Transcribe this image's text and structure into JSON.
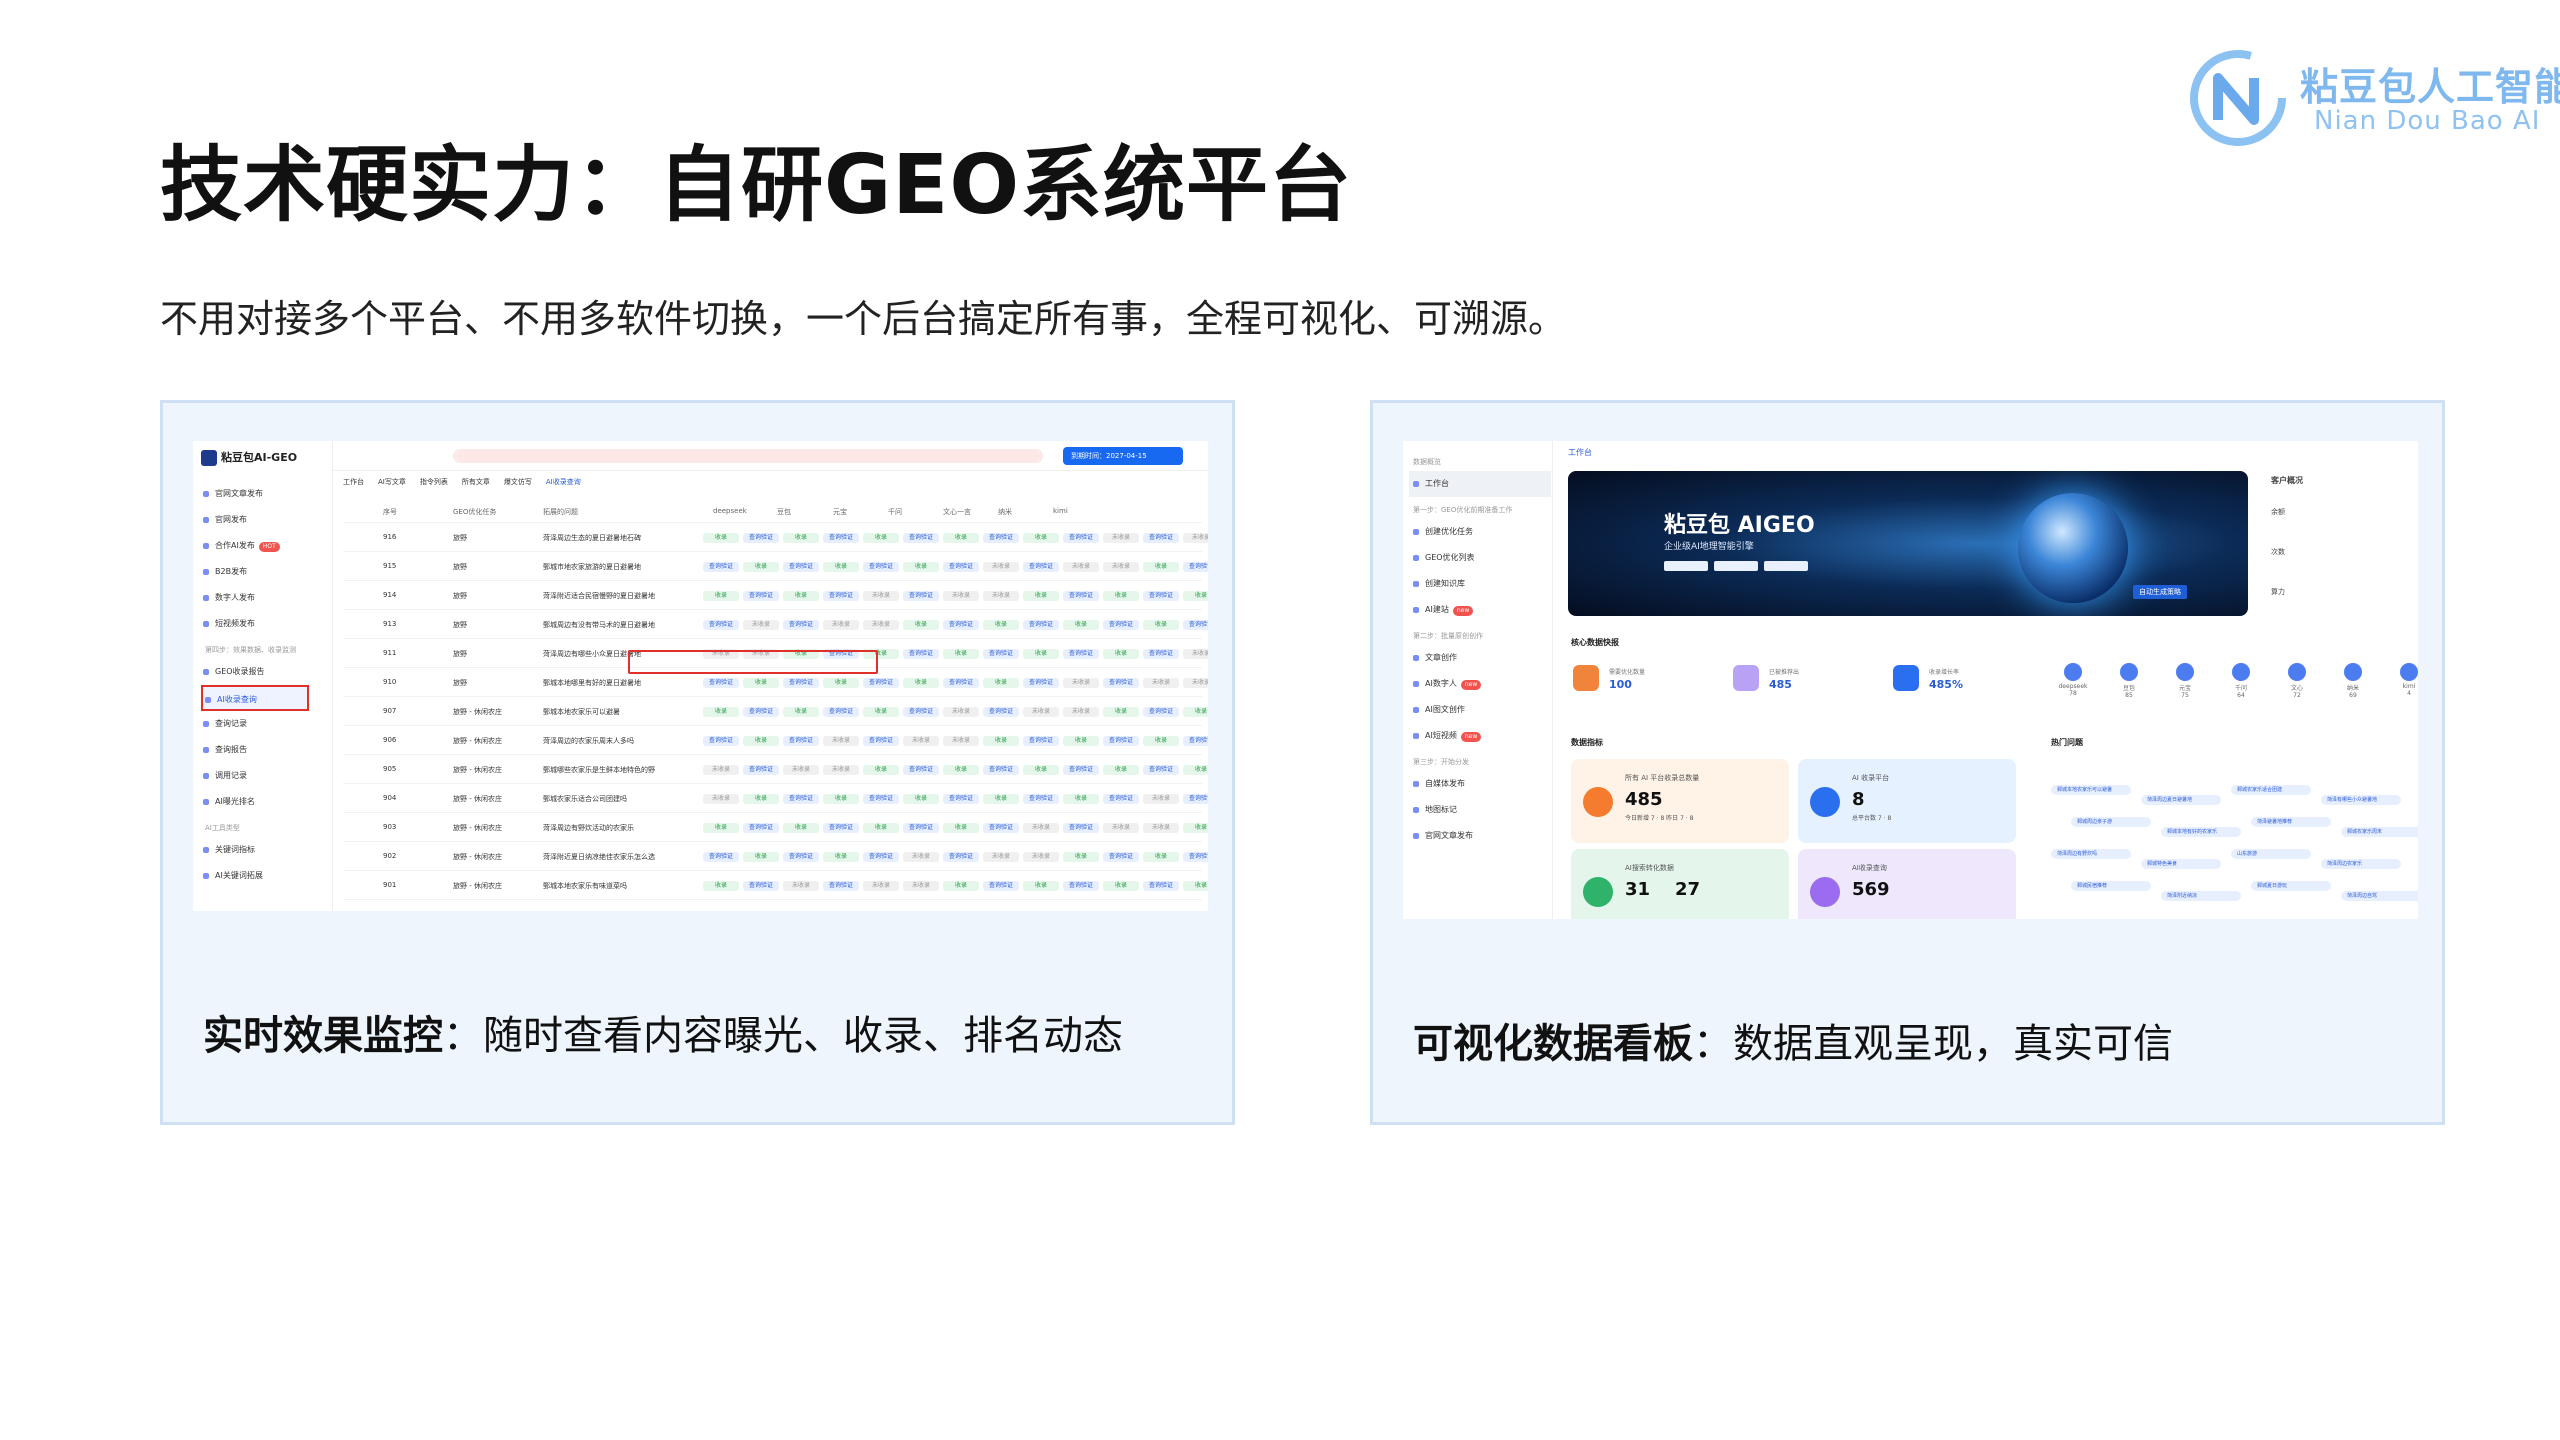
{
  "slide": {
    "title": "技术硬实力：自研GEO系统平台",
    "subtitle": "不用对接多个平台、不用多软件切换，一个后台搞定所有事，全程可视化、可溯源。",
    "logo_cn": "粘豆包人工智能",
    "logo_en": "Nian Dou Bao AI",
    "colors": {
      "accent": "#7fb8ee",
      "panel_bg": "#eef5fd",
      "panel_border": "#cfe0f3",
      "highlight": "#e0302a"
    }
  },
  "left_panel": {
    "caption_bold": "实时效果监控",
    "caption_rest": "：随时查看内容曝光、收录、排名动态",
    "app": {
      "brand": "粘豆包AI-GEO",
      "date_badge": "到期时间：2027-04-15",
      "menu": [
        {
          "label": "官网文章发布",
          "type": "item"
        },
        {
          "label": "官网发布",
          "type": "item"
        },
        {
          "label": "合作AI发布",
          "type": "item",
          "badge": "HOT"
        },
        {
          "label": "B2B发布",
          "type": "item"
        },
        {
          "label": "数字人发布",
          "type": "item"
        },
        {
          "label": "短视频发布",
          "type": "item"
        },
        {
          "label": "第四步：效果数据、收录监测",
          "type": "group"
        },
        {
          "label": "GEO收录报告",
          "type": "item"
        },
        {
          "label": "AI收录查询",
          "type": "item",
          "active": true
        },
        {
          "label": "查询记录",
          "type": "item"
        },
        {
          "label": "查询报告",
          "type": "item"
        },
        {
          "label": "调用记录",
          "type": "item"
        },
        {
          "label": "AI曝光排名",
          "type": "item"
        },
        {
          "label": "AI工具类型",
          "type": "group"
        },
        {
          "label": "关键词指标",
          "type": "item"
        },
        {
          "label": "AI关键词拓展",
          "type": "item"
        }
      ],
      "tabs": [
        "工作台",
        "AI写文章",
        "指令列表",
        "所有文章",
        "爆文仿写",
        "AI收录查询"
      ],
      "columns": [
        "序号",
        "GEO优化任务",
        "拓展的问题",
        "deepseek",
        "豆包",
        "元宝",
        "千问",
        "文心一言",
        "纳米",
        "kimi"
      ],
      "rows": [
        {
          "id": "916",
          "task": "旅野",
          "q": "菏泽周边生态的夏日避暑地石碑"
        },
        {
          "id": "915",
          "task": "旅野",
          "q": "鄄城市地农家旅游的夏日避暑地"
        },
        {
          "id": "914",
          "task": "旅野",
          "q": "菏泽附近适合民宿慢野的夏日避暑地"
        },
        {
          "id": "913",
          "task": "旅野",
          "q": "鄄城周边有没有带马术的夏日避暑地"
        },
        {
          "id": "911",
          "task": "旅野",
          "q": "菏泽周边有哪些小众夏日避暑地"
        },
        {
          "id": "910",
          "task": "旅野",
          "q": "鄄城本地哪里有好的夏日避暑地"
        },
        {
          "id": "907",
          "task": "旅野 - 休闲农庄",
          "q": "鄄城本地农家乐可以避暑"
        },
        {
          "id": "906",
          "task": "旅野 - 休闲农庄",
          "q": "菏泽周边的农家乐周末人多吗"
        },
        {
          "id": "905",
          "task": "旅野 - 休闲农庄",
          "q": "鄄城哪些农家乐是生鲜本地特色的野"
        },
        {
          "id": "904",
          "task": "旅野 - 休闲农庄",
          "q": "鄄城农家乐适合公司团建吗"
        },
        {
          "id": "903",
          "task": "旅野 - 休闲农庄",
          "q": "菏泽周边有野炊活动的农家乐"
        },
        {
          "id": "902",
          "task": "旅野 - 休闲农庄",
          "q": "菏泽附近夏日纳凉绝佳农家乐怎么选"
        },
        {
          "id": "901",
          "task": "旅野 - 休闲农庄",
          "q": "鄄城本地农家乐有味道菜吗"
        }
      ],
      "cell_labels": {
        "g": "收录",
        "b": "查询验证",
        "x": "未收录"
      }
    }
  },
  "right_panel": {
    "caption_bold": "可视化数据看板",
    "caption_rest": "：数据直观呈现，真实可信",
    "app": {
      "crumb": "工作台",
      "menu": [
        {
          "label": "数据概览",
          "type": "group"
        },
        {
          "label": "工作台",
          "type": "item",
          "active": true
        },
        {
          "label": "第一步：GEO优化前期准备工作",
          "type": "group"
        },
        {
          "label": "创建优化任务",
          "type": "item"
        },
        {
          "label": "GEO优化列表",
          "type": "item"
        },
        {
          "label": "创建知识库",
          "type": "item"
        },
        {
          "label": "AI建站",
          "type": "item",
          "badge": "new"
        },
        {
          "label": "第二步：批量原创创作",
          "type": "group"
        },
        {
          "label": "文章创作",
          "type": "item"
        },
        {
          "label": "AI数字人",
          "type": "item",
          "badge": "new"
        },
        {
          "label": "AI图文创作",
          "type": "item"
        },
        {
          "label": "AI短视频",
          "type": "item",
          "badge": "new"
        },
        {
          "label": "第三步：开始分发",
          "type": "group"
        },
        {
          "label": "自媒体发布",
          "type": "item"
        },
        {
          "label": "地图标记",
          "type": "item"
        },
        {
          "label": "官网文章发布",
          "type": "item"
        }
      ],
      "banner_title": "粘豆包 AIGEO",
      "banner_sub": "企业级AI地理智能引擎",
      "banner_tag": "自动生成策略",
      "customer_title": "客户概况",
      "customer_rows": [
        "余额",
        "次数",
        "算力"
      ],
      "core_title": "核心数据快报",
      "kpis": [
        {
          "label": "需要优化数量",
          "value": "100",
          "color": "#f0843b"
        },
        {
          "label": "已被推荐出",
          "value": "485",
          "color": "#b8a2f5"
        },
        {
          "label": "收录增长率",
          "value": "485%",
          "color": "#2a6ff0"
        }
      ],
      "ai_platforms": [
        {
          "name": "deepseek",
          "value": "78"
        },
        {
          "name": "豆包",
          "value": "85"
        },
        {
          "name": "元宝",
          "value": "75"
        },
        {
          "name": "千问",
          "value": "64"
        },
        {
          "name": "文心",
          "value": "72"
        },
        {
          "name": "纳米",
          "value": "69"
        },
        {
          "name": "kimi",
          "value": "4"
        }
      ],
      "metrics_title": "数据指标",
      "hot_title": "热门问题",
      "cards": [
        {
          "title": "所有 AI 平台收录总数量",
          "value": "485",
          "sub": "今日新增 7 · 8   昨日 7 · 8",
          "bg": "#fff2e6",
          "icon": "#f57b2e"
        },
        {
          "title": "AI 收录平台",
          "value": "8",
          "sub": "总平台数 7 · 8",
          "bg": "#e6f1ff",
          "icon": "#2a6ff0"
        },
        {
          "title": "AI搜索转化数据",
          "value": "31",
          "value2": "27",
          "sub": "",
          "bg": "#e4f6ec",
          "icon": "#2fb36a"
        },
        {
          "title": "AI收录查询",
          "value": "569",
          "sub": "",
          "bg": "#efe8fd",
          "icon": "#9b6cf0"
        }
      ],
      "mind_nodes": [
        "鄄城本地农家乐可以避暑",
        "菏泽周边夏日避暑地",
        "鄄城农家乐适合团建",
        "菏泽有哪些小众避暑地",
        "鄄城周边亲子游",
        "鄄城本地有好的农家乐",
        "菏泽避暑地推荐",
        "鄄城农家乐周末",
        "菏泽周边有野炊吗",
        "鄄城特色美食",
        "山东旅游",
        "菏泽周边农家乐",
        "鄄城民宿推荐",
        "菏泽附近纳凉",
        "鄄城夏日游玩",
        "菏泽周边自驾"
      ]
    }
  }
}
